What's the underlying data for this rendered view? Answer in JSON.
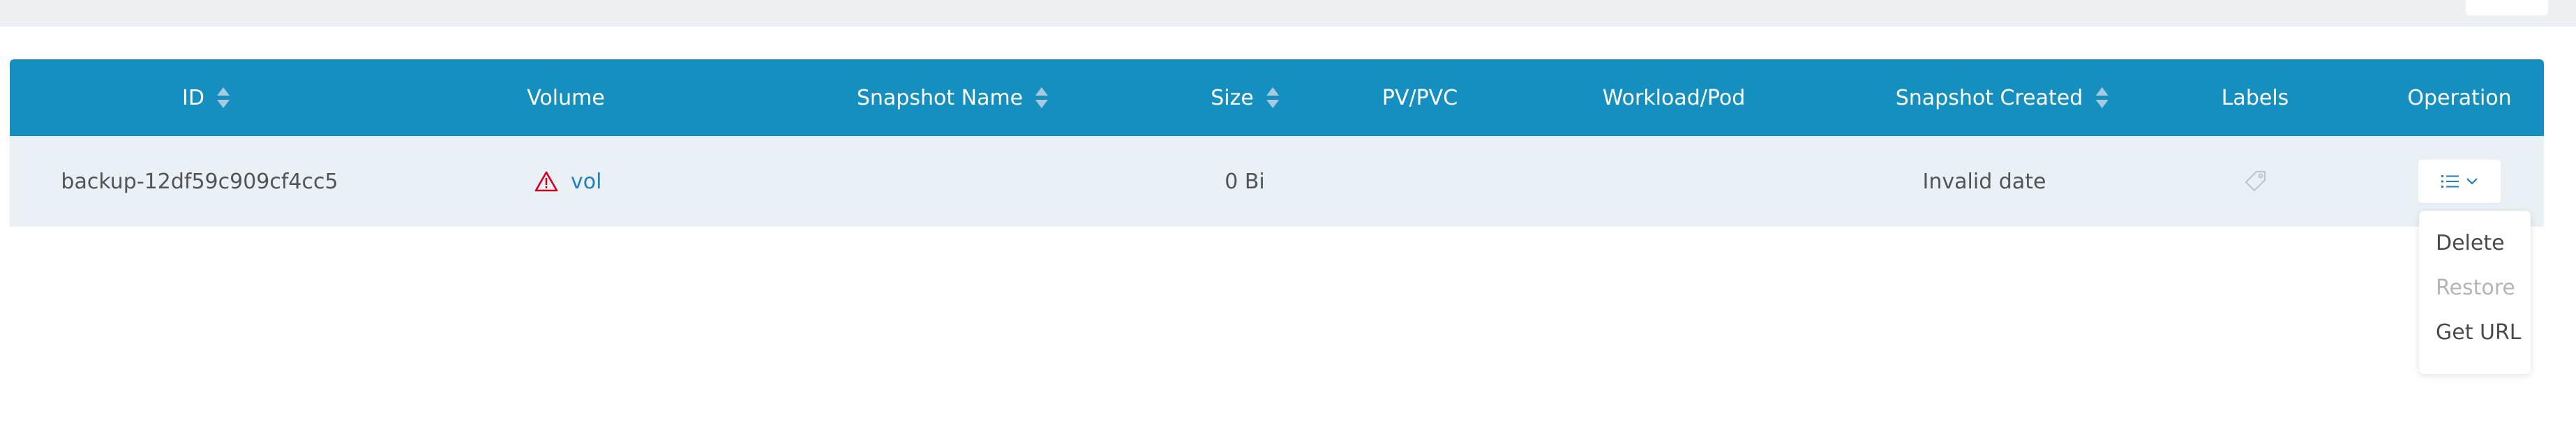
{
  "table": {
    "columns": [
      {
        "key": "id",
        "label": "ID",
        "sortable": true
      },
      {
        "key": "volume",
        "label": "Volume",
        "sortable": false
      },
      {
        "key": "snapshot_name",
        "label": "Snapshot Name",
        "sortable": true
      },
      {
        "key": "size",
        "label": "Size",
        "sortable": true
      },
      {
        "key": "pv_pvc",
        "label": "PV/PVC",
        "sortable": false
      },
      {
        "key": "workload_pod",
        "label": "Workload/Pod",
        "sortable": false
      },
      {
        "key": "snapshot_created",
        "label": "Snapshot Created",
        "sortable": true
      },
      {
        "key": "labels",
        "label": "Labels",
        "sortable": false
      },
      {
        "key": "operation",
        "label": "Operation",
        "sortable": false
      }
    ],
    "rows": [
      {
        "id": "backup-12df59c909cf4cc5",
        "volume": "vol",
        "snapshot_name": "",
        "size": "0 Bi",
        "pv_pvc": "",
        "workload_pod": "",
        "snapshot_created": "Invalid date"
      }
    ]
  },
  "operation_menu": {
    "items": [
      {
        "label": "Delete",
        "disabled": false
      },
      {
        "label": "Restore",
        "disabled": true
      },
      {
        "label": "Get URL",
        "disabled": false
      }
    ]
  },
  "colors": {
    "header_bg": "#148fc0",
    "row_bg": "#e9f1f6",
    "link": "#1f7fc4",
    "warning": "#d0021b"
  },
  "icons": {
    "sort": "sort-icon",
    "warning": "warning-triangle-icon",
    "labels": "tag-icon",
    "operation": "list-icon",
    "dropdown": "chevron-down-icon"
  }
}
